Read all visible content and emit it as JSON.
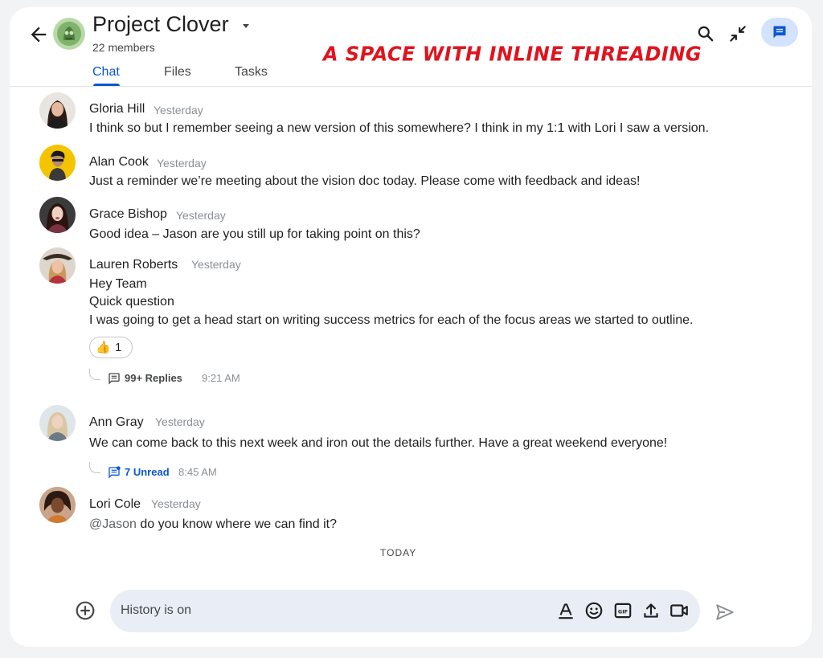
{
  "header": {
    "title": "Project Clover",
    "members": "22 members",
    "banner": "A SPACE WITH INLINE THREADING",
    "tabs": [
      {
        "label": "Chat",
        "active": true
      },
      {
        "label": "Files",
        "active": false
      },
      {
        "label": "Tasks",
        "active": false
      }
    ],
    "icons": [
      "back-arrow-icon",
      "search-icon",
      "minimize-icon",
      "chat-icon"
    ]
  },
  "messages": [
    {
      "sender": "Gloria Hill",
      "time": "Yesterday",
      "lines": [
        "I think so but I remember seeing a new version of this somewhere? I think in my 1:1 with Lori I saw a version."
      ]
    },
    {
      "sender": "Alan Cook",
      "time": "Yesterday",
      "lines": [
        "Just a reminder we’re meeting about the vision doc today. Please come with feedback and ideas!"
      ]
    },
    {
      "sender": "Grace Bishop",
      "time": "Yesterday",
      "lines": [
        "Good idea – Jason are you still up for taking point on this?"
      ]
    },
    {
      "sender": "Lauren Roberts",
      "time": "Yesterday",
      "lines": [
        "Hey Team",
        "Quick question",
        "I was going to get a head start on writing success metrics for each of the focus areas we started to outline."
      ],
      "reaction": {
        "emoji": "👍",
        "count": "1"
      },
      "thread": {
        "label": "99+ Replies",
        "time": "9:21 AM"
      }
    },
    {
      "sender": "Ann Gray",
      "time": "Yesterday",
      "lines": [
        "We can come back to this next week and iron out the details further. Have a great weekend everyone!"
      ],
      "thread": {
        "label": "7 Unread",
        "time": "8:45 AM"
      }
    },
    {
      "sender": "Lori Cole",
      "time": "Yesterday",
      "mention": "@Jason",
      "lines": [
        " do you know where we can find it?"
      ]
    }
  ],
  "divider": "TODAY",
  "composer": {
    "placeholder": "History is on",
    "tools": [
      "format-text-icon",
      "emoji-icon",
      "gif-icon",
      "upload-icon",
      "video-call-icon"
    ]
  },
  "colors": {
    "accent": "#0b57d0",
    "banner": "#e0141e",
    "composer_bg": "#e9eef6",
    "chat_btn_bg": "#d3e3fd"
  }
}
